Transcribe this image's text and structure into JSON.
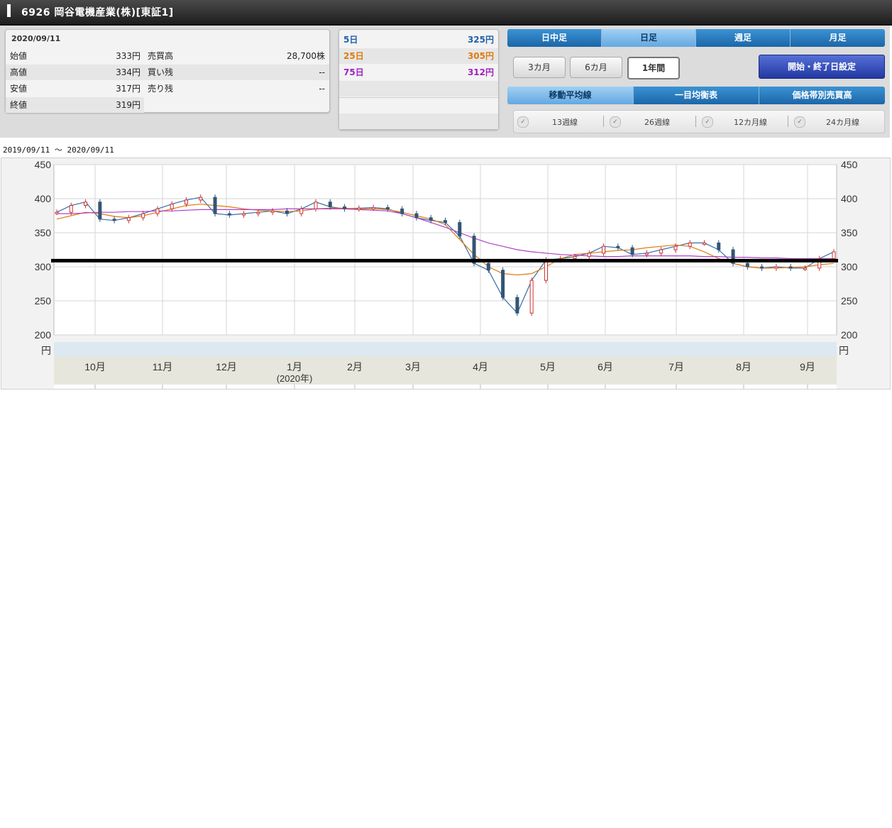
{
  "header": {
    "title": "6926 岡谷電機産業(株)[東証1]"
  },
  "quote": {
    "date": "2020/09/11",
    "rows": [
      {
        "label1": "始値",
        "value1": "333円",
        "label2": "売買高",
        "value2": "28,700株"
      },
      {
        "label1": "高値",
        "value1": "334円",
        "label2": "買い残",
        "value2": "--"
      },
      {
        "label1": "安値",
        "value1": "317円",
        "label2": "売り残",
        "value2": "--"
      },
      {
        "label1": "終値",
        "value1": "319円",
        "label2": "",
        "value2": ""
      }
    ]
  },
  "moving_averages": [
    {
      "label": "5日",
      "value": "325円",
      "color": "#1f5fa8"
    },
    {
      "label": "25日",
      "value": "305円",
      "color": "#e07a10"
    },
    {
      "label": "75日",
      "value": "312円",
      "color": "#a020c0"
    }
  ],
  "period_tabs": [
    "日中足",
    "日足",
    "週足",
    "月足"
  ],
  "period_selected": "日足",
  "range_buttons": [
    "3カ月",
    "6カ月",
    "1年間"
  ],
  "range_selected": "1年間",
  "date_setting_button": "開始・終了日設定",
  "indicator_tabs": [
    "移動平均線",
    "一目均衡表",
    "価格帯別売買高"
  ],
  "ma_options": [
    "13週線",
    "26週線",
    "12カ月線",
    "24カ月線"
  ],
  "date_range_label": "2019/09/11 〜 2020/09/11",
  "chart_data": {
    "type": "line",
    "y_ticks": [
      "450",
      "400",
      "350",
      "300",
      "250",
      "200"
    ],
    "unit_left": "円",
    "unit_right": "円",
    "ylim": [
      200,
      450
    ],
    "month_labels": [
      "10月",
      "11月",
      "12月",
      "1月",
      "2月",
      "3月",
      "4月",
      "5月",
      "6月",
      "7月",
      "8月",
      "9月"
    ],
    "year_note": "(2020年)",
    "reference_line": 309,
    "x_weeks": [
      0,
      1,
      2,
      3,
      4,
      5,
      6,
      7,
      8,
      9,
      10,
      11,
      12,
      13,
      14,
      15,
      16,
      17,
      18,
      19,
      20,
      21,
      22,
      23,
      24,
      25,
      26,
      27,
      28,
      29,
      30,
      31,
      32,
      33,
      34,
      35,
      36,
      37,
      38,
      39,
      40,
      41,
      42,
      43,
      44,
      45,
      46,
      47,
      48,
      49,
      50,
      51,
      52
    ],
    "series": [
      {
        "color": "#3a6ea5",
        "values": [
          380,
          390,
          395,
          370,
          368,
          372,
          378,
          385,
          392,
          398,
          402,
          378,
          376,
          378,
          380,
          382,
          378,
          385,
          395,
          388,
          385,
          386,
          387,
          385,
          378,
          372,
          368,
          365,
          345,
          305,
          295,
          255,
          232,
          280,
          310,
          312,
          315,
          320,
          330,
          328,
          318,
          320,
          325,
          330,
          335,
          335,
          325,
          305,
          300,
          298,
          300,
          298,
          298,
          312,
          322
        ]
      },
      {
        "color": "#e07a10",
        "values": [
          370,
          375,
          380,
          378,
          374,
          372,
          375,
          380,
          385,
          390,
          392,
          390,
          388,
          385,
          383,
          382,
          381,
          382,
          385,
          386,
          386,
          385,
          385,
          384,
          380,
          375,
          370,
          362,
          340,
          318,
          300,
          290,
          288,
          290,
          300,
          312,
          318,
          320,
          322,
          324,
          325,
          328,
          330,
          332,
          330,
          322,
          312,
          305,
          300,
          298,
          298,
          299,
          300,
          303,
          305
        ]
      },
      {
        "color": "#b040c8",
        "values": [
          378,
          378,
          379,
          380,
          380,
          381,
          381,
          382,
          382,
          383,
          384,
          384,
          384,
          384,
          384,
          384,
          385,
          385,
          385,
          385,
          385,
          384,
          383,
          382,
          378,
          372,
          365,
          358,
          350,
          342,
          335,
          330,
          325,
          322,
          320,
          318,
          317,
          316,
          315,
          315,
          316,
          316,
          316,
          316,
          316,
          315,
          315,
          314,
          314,
          313,
          313,
          312,
          312,
          312,
          312
        ]
      }
    ]
  }
}
